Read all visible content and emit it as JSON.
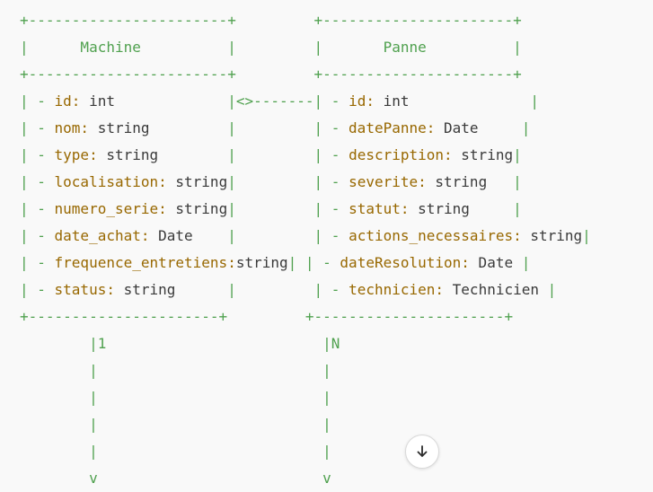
{
  "diagram": {
    "lines": [
      [
        {
          "c": "g",
          "t": "+-----------------------+         +----------------------+"
        }
      ],
      [
        {
          "c": "g",
          "t": "|      Machine          |         |       Panne          |"
        }
      ],
      [
        {
          "c": "g",
          "t": "+-----------------------+         +----------------------+"
        }
      ],
      [
        {
          "c": "g",
          "t": "| - "
        },
        {
          "c": "k",
          "t": "id:"
        },
        {
          "c": "t",
          "t": " int             "
        },
        {
          "c": "g",
          "t": "|<>-------| - "
        },
        {
          "c": "k",
          "t": "id:"
        },
        {
          "c": "t",
          "t": " int              "
        },
        {
          "c": "g",
          "t": "|"
        }
      ],
      [
        {
          "c": "g",
          "t": "| - "
        },
        {
          "c": "k",
          "t": "nom:"
        },
        {
          "c": "t",
          "t": " string         "
        },
        {
          "c": "g",
          "t": "|         | - "
        },
        {
          "c": "k",
          "t": "datePanne:"
        },
        {
          "c": "t",
          "t": " Date     "
        },
        {
          "c": "g",
          "t": "|"
        }
      ],
      [
        {
          "c": "g",
          "t": "| - "
        },
        {
          "c": "k",
          "t": "type:"
        },
        {
          "c": "t",
          "t": " string        "
        },
        {
          "c": "g",
          "t": "|         | - "
        },
        {
          "c": "k",
          "t": "description:"
        },
        {
          "c": "t",
          "t": " string"
        },
        {
          "c": "g",
          "t": "|"
        }
      ],
      [
        {
          "c": "g",
          "t": "| - "
        },
        {
          "c": "k",
          "t": "localisation:"
        },
        {
          "c": "t",
          "t": " string"
        },
        {
          "c": "g",
          "t": "|         | - "
        },
        {
          "c": "k",
          "t": "severite:"
        },
        {
          "c": "t",
          "t": " string   "
        },
        {
          "c": "g",
          "t": "|"
        }
      ],
      [
        {
          "c": "g",
          "t": "| - "
        },
        {
          "c": "k",
          "t": "numero_serie:"
        },
        {
          "c": "t",
          "t": " string"
        },
        {
          "c": "g",
          "t": "|         | - "
        },
        {
          "c": "k",
          "t": "statut:"
        },
        {
          "c": "t",
          "t": " string     "
        },
        {
          "c": "g",
          "t": "|"
        }
      ],
      [
        {
          "c": "g",
          "t": "| - "
        },
        {
          "c": "k",
          "t": "date_achat:"
        },
        {
          "c": "t",
          "t": " Date    "
        },
        {
          "c": "g",
          "t": "|         | - "
        },
        {
          "c": "k",
          "t": "actions_necessaires:"
        },
        {
          "c": "t",
          "t": " string"
        },
        {
          "c": "g",
          "t": "|"
        }
      ],
      [
        {
          "c": "g",
          "t": "| - "
        },
        {
          "c": "k",
          "t": "frequence_entretiens:"
        },
        {
          "c": "t",
          "t": "string"
        },
        {
          "c": "g",
          "t": "| | - "
        },
        {
          "c": "k",
          "t": "dateResolution:"
        },
        {
          "c": "t",
          "t": " Date "
        },
        {
          "c": "g",
          "t": "|"
        }
      ],
      [
        {
          "c": "g",
          "t": "| - "
        },
        {
          "c": "k",
          "t": "status:"
        },
        {
          "c": "t",
          "t": " string      "
        },
        {
          "c": "g",
          "t": "|         | - "
        },
        {
          "c": "k",
          "t": "technicien:"
        },
        {
          "c": "t",
          "t": " Technicien "
        },
        {
          "c": "g",
          "t": "|"
        }
      ],
      [
        {
          "c": "g",
          "t": "+----------------------+         +----------------------+"
        }
      ],
      [
        {
          "c": "g",
          "t": "        |1                         |N"
        }
      ],
      [
        {
          "c": "g",
          "t": "        |                          |"
        }
      ],
      [
        {
          "c": "g",
          "t": "        |                          |"
        }
      ],
      [
        {
          "c": "g",
          "t": "        |                          |"
        }
      ],
      [
        {
          "c": "g",
          "t": "        |                          |"
        }
      ],
      [
        {
          "c": "g",
          "t": "        v                          v"
        }
      ]
    ]
  },
  "scroll_button": {
    "icon": "arrow-down-icon"
  }
}
